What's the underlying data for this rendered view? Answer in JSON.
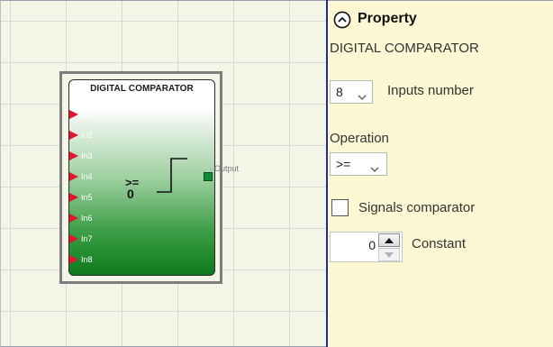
{
  "canvas": {
    "block": {
      "title": "DIGITAL COMPARATOR",
      "inputs": [
        "In1",
        "In2",
        "In3",
        "In4",
        "In5",
        "In6",
        "In7",
        "In8"
      ],
      "operator": ">=",
      "constant": "0",
      "output_label": "Output"
    }
  },
  "property_panel": {
    "title": "Property",
    "component_name": "DIGITAL COMPARATOR",
    "inputs_number": {
      "value": "8",
      "label": "Inputs number"
    },
    "operation": {
      "label": "Operation",
      "value": ">="
    },
    "signals_comparator": {
      "label": "Signals comparator",
      "checked": false
    },
    "constant": {
      "value": "0",
      "label": "Constant"
    }
  },
  "colors": {
    "canvas_bg": "#f4f5e6",
    "panel_bg": "#fdf8d3",
    "pin_red": "#e8122a",
    "block_green": "#0f7a1c",
    "output_port": "#0f8a36"
  },
  "icons": {
    "collapse": "chevron-up-circle-icon",
    "pin": "input-pin-triangle-icon",
    "step": "step-function-icon",
    "dropdown": "chevron-down-icon",
    "spin_up": "spin-up-icon",
    "spin_down": "spin-down-icon"
  }
}
